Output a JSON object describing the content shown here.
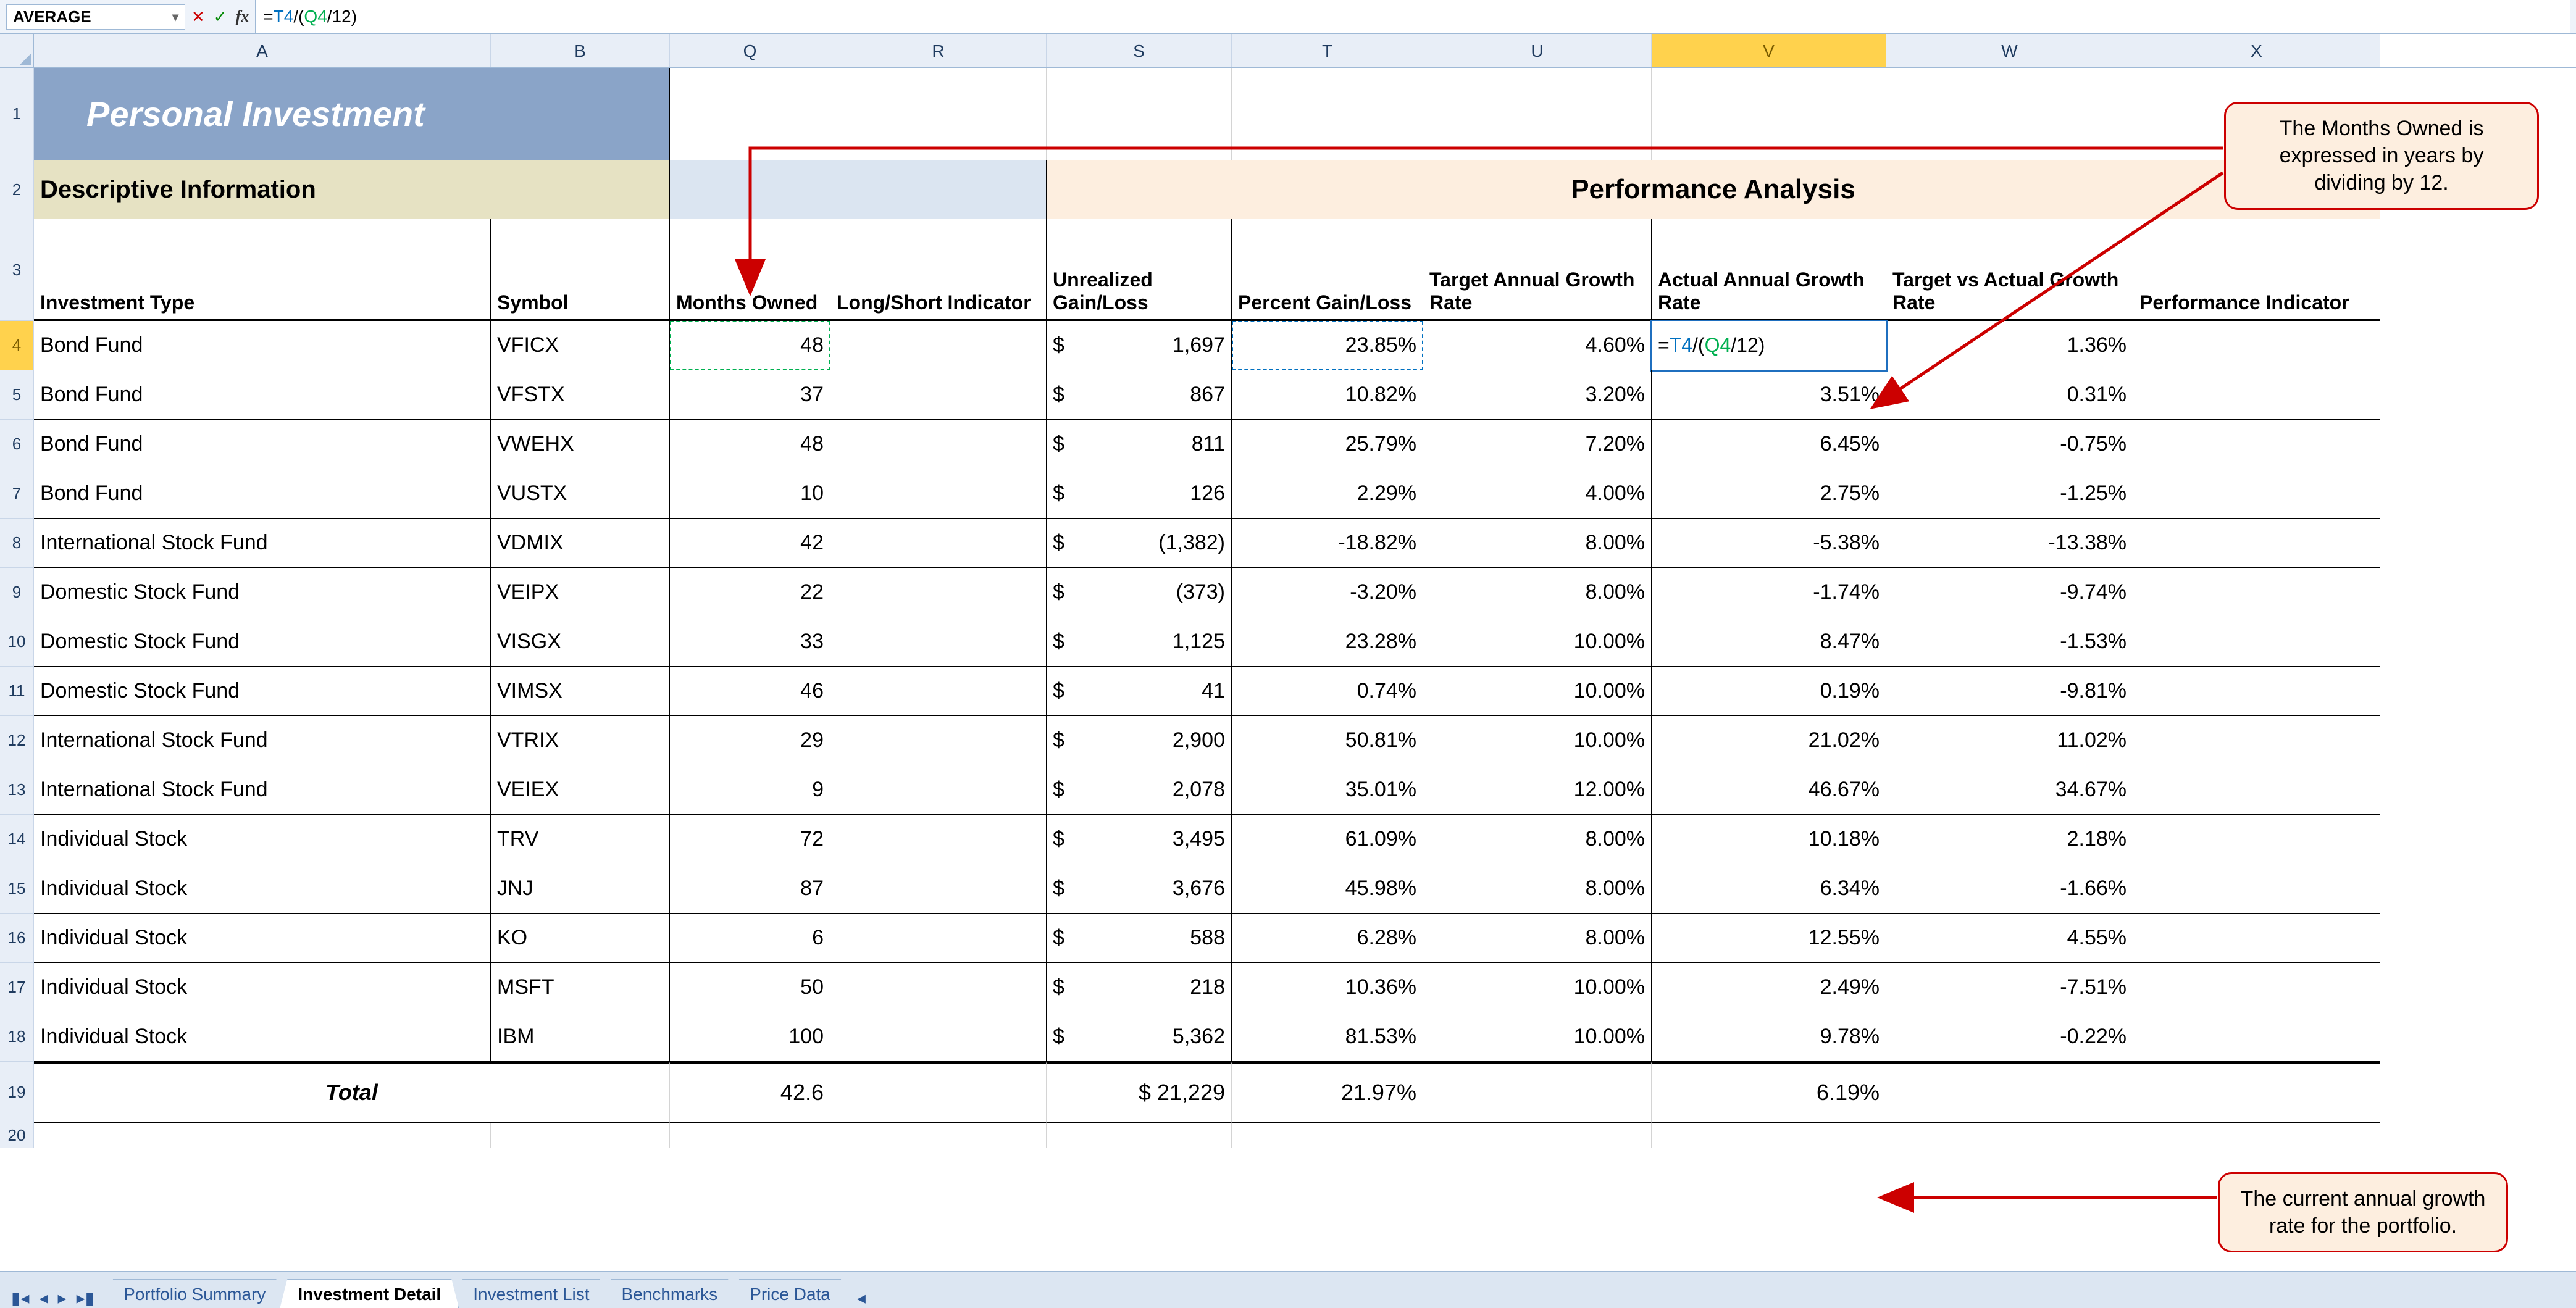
{
  "nameBox": "AVERAGE",
  "formulaPlain": "=T4/(Q4/12)",
  "formulaParts": {
    "eq": "=",
    "r1": "T4",
    "mid": "/(",
    "r2": "Q4",
    "tail": "/12)"
  },
  "columns": [
    "A",
    "B",
    "Q",
    "R",
    "S",
    "T",
    "U",
    "V",
    "W",
    "X"
  ],
  "selectedCol": "V",
  "selectedRow": 4,
  "titles": {
    "main": "Personal Investment",
    "descSection": "Descriptive Information",
    "perfSection": "Performance Analysis"
  },
  "headers": {
    "A": "Investment Type",
    "B": "Symbol",
    "Q": "Months Owned",
    "R": "Long/Short Indicator",
    "S": "Unrealized Gain/Loss",
    "T": "Percent Gain/Loss",
    "U": "Target Annual Growth Rate",
    "V": "Actual Annual Growth Rate",
    "W": "Target vs Actual Growth Rate",
    "X": "Performance Indicator"
  },
  "rows": [
    {
      "n": 4,
      "A": "Bond Fund",
      "B": "VFICX",
      "Q": "48",
      "R": "",
      "S": "1,697",
      "Sneg": false,
      "T": "23.85%",
      "U": "4.60%",
      "V_formula": "=T4/(Q4/12)",
      "W": "1.36%",
      "X": ""
    },
    {
      "n": 5,
      "A": "Bond Fund",
      "B": "VFSTX",
      "Q": "37",
      "R": "",
      "S": "867",
      "Sneg": false,
      "T": "10.82%",
      "U": "3.20%",
      "V": "3.51%",
      "W": "0.31%",
      "X": ""
    },
    {
      "n": 6,
      "A": "Bond Fund",
      "B": "VWEHX",
      "Q": "48",
      "R": "",
      "S": "811",
      "Sneg": false,
      "T": "25.79%",
      "U": "7.20%",
      "V": "6.45%",
      "W": "-0.75%",
      "X": ""
    },
    {
      "n": 7,
      "A": "Bond Fund",
      "B": "VUSTX",
      "Q": "10",
      "R": "",
      "S": "126",
      "Sneg": false,
      "T": "2.29%",
      "U": "4.00%",
      "V": "2.75%",
      "W": "-1.25%",
      "X": ""
    },
    {
      "n": 8,
      "A": "International Stock Fund",
      "B": "VDMIX",
      "Q": "42",
      "R": "",
      "S": "(1,382)",
      "Sneg": true,
      "T": "-18.82%",
      "U": "8.00%",
      "V": "-5.38%",
      "W": "-13.38%",
      "X": ""
    },
    {
      "n": 9,
      "A": "Domestic Stock Fund",
      "B": "VEIPX",
      "Q": "22",
      "R": "",
      "S": "(373)",
      "Sneg": true,
      "T": "-3.20%",
      "U": "8.00%",
      "V": "-1.74%",
      "W": "-9.74%",
      "X": ""
    },
    {
      "n": 10,
      "A": "Domestic Stock Fund",
      "B": "VISGX",
      "Q": "33",
      "R": "",
      "S": "1,125",
      "Sneg": false,
      "T": "23.28%",
      "U": "10.00%",
      "V": "8.47%",
      "W": "-1.53%",
      "X": ""
    },
    {
      "n": 11,
      "A": "Domestic Stock Fund",
      "B": "VIMSX",
      "Q": "46",
      "R": "",
      "S": "41",
      "Sneg": false,
      "T": "0.74%",
      "U": "10.00%",
      "V": "0.19%",
      "W": "-9.81%",
      "X": ""
    },
    {
      "n": 12,
      "A": "International Stock Fund",
      "B": "VTRIX",
      "Q": "29",
      "R": "",
      "S": "2,900",
      "Sneg": false,
      "T": "50.81%",
      "U": "10.00%",
      "V": "21.02%",
      "W": "11.02%",
      "X": ""
    },
    {
      "n": 13,
      "A": "International Stock Fund",
      "B": "VEIEX",
      "Q": "9",
      "R": "",
      "S": "2,078",
      "Sneg": false,
      "T": "35.01%",
      "U": "12.00%",
      "V": "46.67%",
      "W": "34.67%",
      "X": ""
    },
    {
      "n": 14,
      "A": "Individual Stock",
      "B": "TRV",
      "Q": "72",
      "R": "",
      "S": "3,495",
      "Sneg": false,
      "T": "61.09%",
      "U": "8.00%",
      "V": "10.18%",
      "W": "2.18%",
      "X": ""
    },
    {
      "n": 15,
      "A": "Individual Stock",
      "B": "JNJ",
      "Q": "87",
      "R": "",
      "S": "3,676",
      "Sneg": false,
      "T": "45.98%",
      "U": "8.00%",
      "V": "6.34%",
      "W": "-1.66%",
      "X": ""
    },
    {
      "n": 16,
      "A": "Individual Stock",
      "B": "KO",
      "Q": "6",
      "R": "",
      "S": "588",
      "Sneg": false,
      "T": "6.28%",
      "U": "8.00%",
      "V": "12.55%",
      "W": "4.55%",
      "X": ""
    },
    {
      "n": 17,
      "A": "Individual Stock",
      "B": "MSFT",
      "Q": "50",
      "R": "",
      "S": "218",
      "Sneg": false,
      "T": "10.36%",
      "U": "10.00%",
      "V": "2.49%",
      "W": "-7.51%",
      "X": ""
    },
    {
      "n": 18,
      "A": "Individual Stock",
      "B": "IBM",
      "Q": "100",
      "R": "",
      "S": "5,362",
      "Sneg": false,
      "T": "81.53%",
      "U": "10.00%",
      "V": "9.78%",
      "W": "-0.22%",
      "X": ""
    }
  ],
  "total": {
    "n": 19,
    "label": "Total",
    "Q": "42.6",
    "S": "$ 21,229",
    "T": "21.97%",
    "V": "6.19%"
  },
  "sheetTabs": [
    "Portfolio Summary",
    "Investment Detail",
    "Investment List",
    "Benchmarks",
    "Price Data"
  ],
  "activeTab": 1,
  "callouts": {
    "c1": "The Months Owned is expressed in years by dividing by 12.",
    "c2": "The current annual growth rate for the portfolio."
  },
  "chart_data": {
    "type": "table",
    "title": "Personal Investment — Investment Detail",
    "columns": [
      "Investment Type",
      "Symbol",
      "Months Owned",
      "Unrealized Gain/Loss ($)",
      "Percent Gain/Loss (%)",
      "Target Annual Growth Rate (%)",
      "Actual Annual Growth Rate (%)",
      "Target vs Actual Growth Rate (%)"
    ],
    "rows": [
      [
        "Bond Fund",
        "VFICX",
        48,
        1697,
        23.85,
        4.6,
        null,
        1.36
      ],
      [
        "Bond Fund",
        "VFSTX",
        37,
        867,
        10.82,
        3.2,
        3.51,
        0.31
      ],
      [
        "Bond Fund",
        "VWEHX",
        48,
        811,
        25.79,
        7.2,
        6.45,
        -0.75
      ],
      [
        "Bond Fund",
        "VUSTX",
        10,
        126,
        2.29,
        4.0,
        2.75,
        -1.25
      ],
      [
        "International Stock Fund",
        "VDMIX",
        42,
        -1382,
        -18.82,
        8.0,
        -5.38,
        -13.38
      ],
      [
        "Domestic Stock Fund",
        "VEIPX",
        22,
        -373,
        -3.2,
        8.0,
        -1.74,
        -9.74
      ],
      [
        "Domestic Stock Fund",
        "VISGX",
        33,
        1125,
        23.28,
        10.0,
        8.47,
        -1.53
      ],
      [
        "Domestic Stock Fund",
        "VIMSX",
        46,
        41,
        0.74,
        10.0,
        0.19,
        -9.81
      ],
      [
        "International Stock Fund",
        "VTRIX",
        29,
        2900,
        50.81,
        10.0,
        21.02,
        11.02
      ],
      [
        "International Stock Fund",
        "VEIEX",
        9,
        2078,
        35.01,
        12.0,
        46.67,
        34.67
      ],
      [
        "Individual Stock",
        "TRV",
        72,
        3495,
        61.09,
        8.0,
        10.18,
        2.18
      ],
      [
        "Individual Stock",
        "JNJ",
        87,
        3676,
        45.98,
        8.0,
        6.34,
        -1.66
      ],
      [
        "Individual Stock",
        "KO",
        6,
        588,
        6.28,
        8.0,
        12.55,
        4.55
      ],
      [
        "Individual Stock",
        "MSFT",
        50,
        218,
        10.36,
        10.0,
        2.49,
        -7.51
      ],
      [
        "Individual Stock",
        "IBM",
        100,
        5362,
        81.53,
        10.0,
        9.78,
        -0.22
      ]
    ],
    "totals": {
      "Months Owned": 42.6,
      "Unrealized Gain/Loss ($)": 21229,
      "Percent Gain/Loss (%)": 21.97,
      "Actual Annual Growth Rate (%)": 6.19
    },
    "notes": [
      "Actual Annual Growth Rate formula for row 4: =T4/(Q4/12)"
    ]
  }
}
